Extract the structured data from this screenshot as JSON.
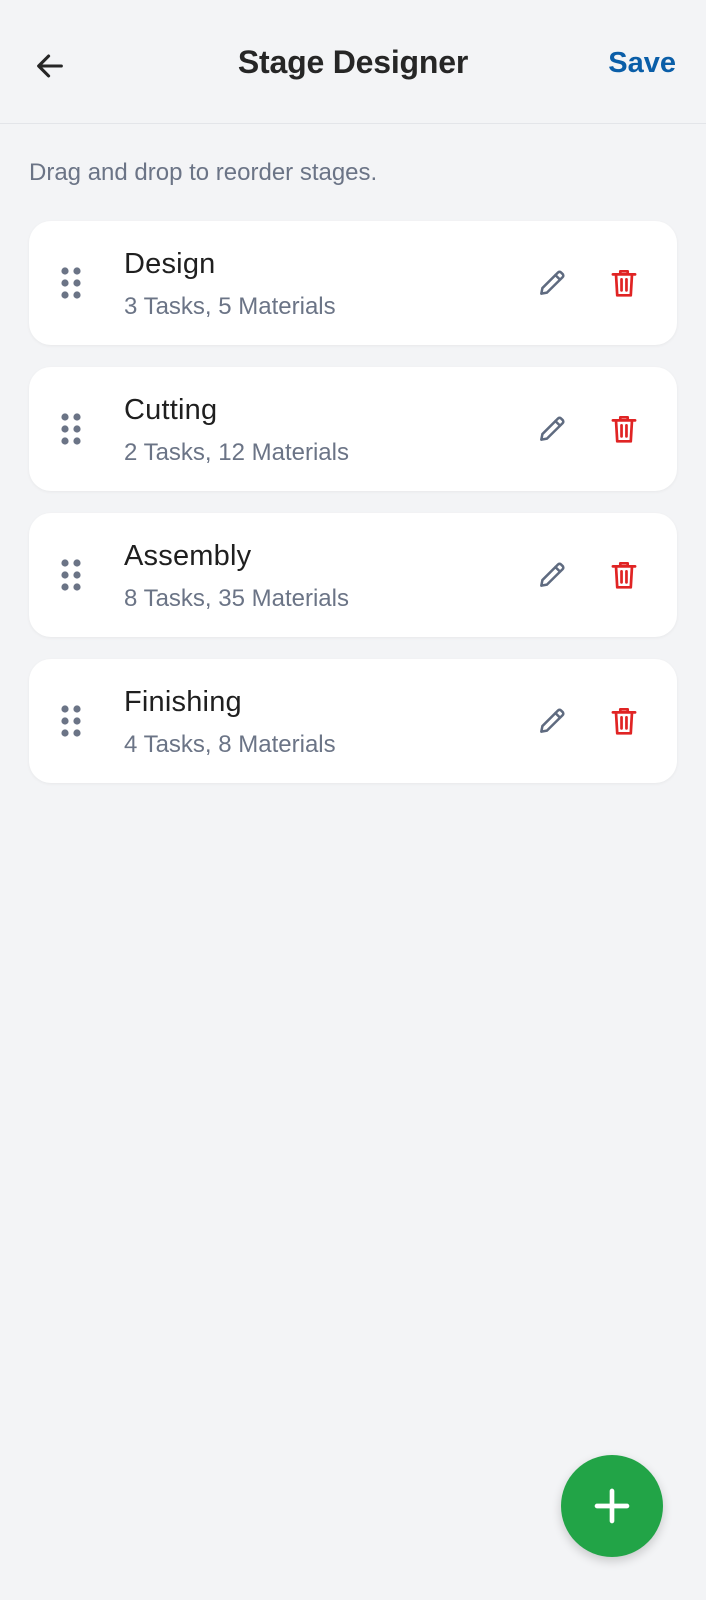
{
  "header": {
    "title": "Stage Designer",
    "save_label": "Save",
    "back_icon": "arrow-left-icon"
  },
  "hint": "Drag and drop to reorder stages.",
  "stages": [
    {
      "name": "Design",
      "meta": "3 Tasks, 5 Materials"
    },
    {
      "name": "Cutting",
      "meta": "2 Tasks, 12 Materials"
    },
    {
      "name": "Assembly",
      "meta": "8 Tasks, 35 Materials"
    },
    {
      "name": "Finishing",
      "meta": "4 Tasks, 8 Materials"
    }
  ],
  "icons": {
    "drag": "drag-handle-icon",
    "edit": "pencil-icon",
    "delete": "trash-icon",
    "add": "plus-icon"
  },
  "colors": {
    "background": "#f3f4f6",
    "accent": "#0a5ea8",
    "danger": "#e02424",
    "fab": "#22a447",
    "muted": "#6b7486"
  }
}
